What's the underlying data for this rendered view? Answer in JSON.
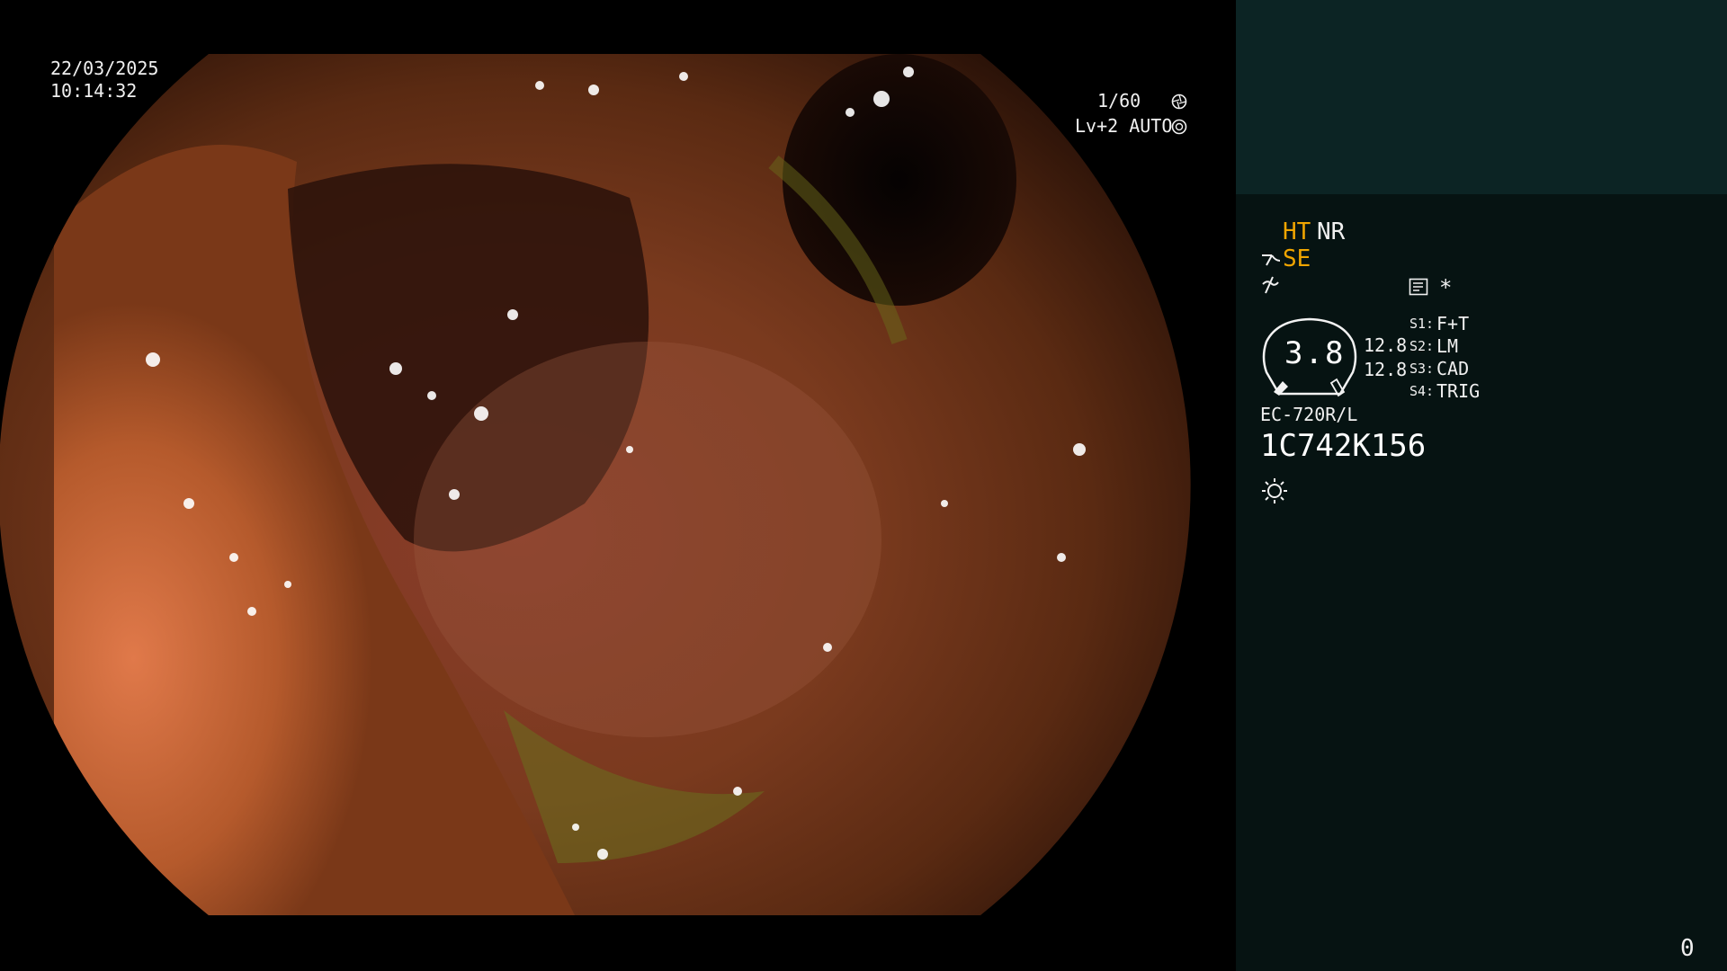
{
  "overlay": {
    "date": "22/03/2025",
    "time": "10:14:32",
    "shutter": "1/60",
    "level": "Lv+2 AUTO"
  },
  "panel": {
    "mode1_ht": "HT",
    "mode1_nr": "NR",
    "mode2": "SE",
    "scope_value": "3.8",
    "val_top": "12.8",
    "val_bottom": "12.8",
    "s_labels": [
      {
        "key": "S1:",
        "val": "F+T"
      },
      {
        "key": "S2:",
        "val": "LM"
      },
      {
        "key": "S3:",
        "val": "CAD"
      },
      {
        "key": "S4:",
        "val": "TRIG"
      }
    ],
    "star": "*",
    "model": "EC-720R/L",
    "serial": "1C742K156",
    "counter": "0"
  },
  "colors": {
    "accent": "#f0a500",
    "panel_bg": "#061312",
    "panel_top": "#0c2424"
  },
  "icons": [
    "shutter-icon",
    "auto-iris-icon",
    "scope-wave-icon",
    "scope-tilde-icon",
    "menu-list-icon",
    "light-icon"
  ]
}
